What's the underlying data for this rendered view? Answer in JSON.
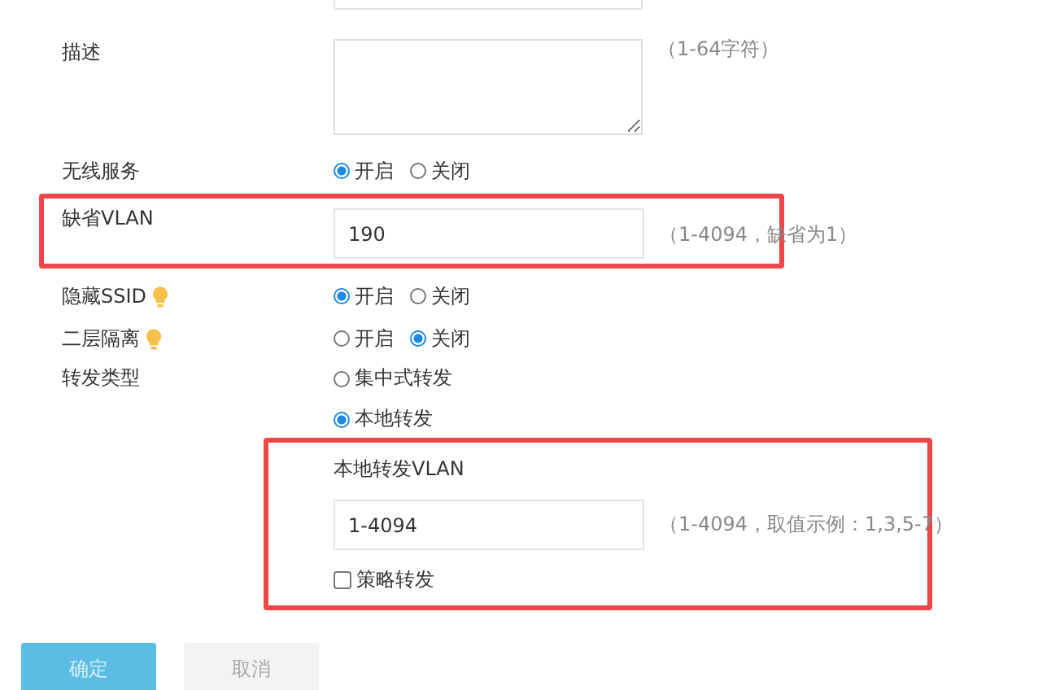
{
  "description": {
    "label": "描述",
    "hint": "（1-64字符）"
  },
  "wireless_service": {
    "label": "无线服务",
    "options": [
      {
        "label": "开启",
        "selected": true
      },
      {
        "label": "关闭",
        "selected": false
      }
    ]
  },
  "default_vlan": {
    "label": "缺省VLAN",
    "value": "190",
    "hint": "（1-4094，缺省为1）"
  },
  "hide_ssid": {
    "label": "隐藏SSID",
    "tip": true,
    "options": [
      {
        "label": "开启",
        "selected": true
      },
      {
        "label": "关闭",
        "selected": false
      }
    ]
  },
  "layer2_isolation": {
    "label": "二层隔离",
    "tip": true,
    "options": [
      {
        "label": "开启",
        "selected": false
      },
      {
        "label": "关闭",
        "selected": true
      }
    ]
  },
  "forwarding_type": {
    "label": "转发类型",
    "options": [
      {
        "label": "集中式转发",
        "selected": false
      },
      {
        "label": "本地转发",
        "selected": true
      }
    ]
  },
  "local_vlan": {
    "label": "本地转发VLAN",
    "value": "1-4094",
    "hint": "（1-4094，取值示例：1,3,5-7）"
  },
  "policy_forwarding": {
    "label": "策略转发",
    "checked": false
  },
  "buttons": [
    {
      "label": "确定",
      "kind": "primary"
    },
    {
      "label": "取消",
      "kind": "secondary"
    }
  ]
}
